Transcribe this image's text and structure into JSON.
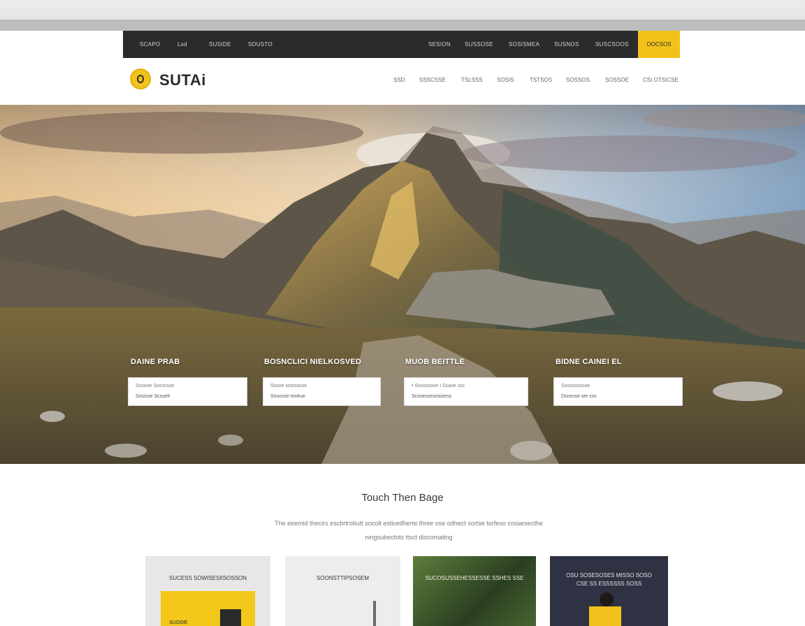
{
  "topbar": {
    "links": [
      "SCAPO",
      "Lsd",
      "SUSIDE",
      "SDUSTO",
      "SESION",
      "SUSSOSE",
      "SOSISMEA",
      "SUSNOS",
      "SUSCSOOS"
    ],
    "cta_label": "OOCSOS"
  },
  "brand": {
    "name": "SUTAi"
  },
  "nav": {
    "items": [
      "SSD",
      "SSSCSSE",
      "TSLSSS",
      "SOSIS",
      "TSTSOS",
      "SOSSOS",
      "SOSSOE",
      "CSI OTSICSE"
    ]
  },
  "hero": {
    "fields": [
      {
        "label": "DAINE PRAB",
        "placeholder": "Sssooe Sosscsse",
        "value": "Sosisse Scsseh"
      },
      {
        "label": "BOSNCLICI NIELKOSVED",
        "placeholder": "Sssoe sosisosse",
        "value": "Sososse tonkue"
      },
      {
        "label": "MUOB BEITTLE",
        "placeholder": "• Sossssose I Scase sss",
        "value": "Scsoessesosisess"
      },
      {
        "label": "BIDNE CAINEI EL",
        "placeholder": "Sssossossoe",
        "value": "Dscesse ste sss"
      }
    ]
  },
  "section": {
    "title": "Touch Then Bage",
    "description_line1": "The eiremid thecirs escbrtrobutt socolt esticedherte three ose odhect sortse torfeso cosiarsecthe",
    "description_line2": "ningsubectots ttsct discomating"
  },
  "cards": [
    {
      "label": "SUCESS SOWISESIISOSSON",
      "badge": "SUOSIE"
    },
    {
      "label": "SOONSTTIPSOSEM"
    },
    {
      "label": "SUCOSUSSEHESSESSE SSHES SSE"
    },
    {
      "label": "OSU SOSESOSES MISSO SOSO CSE SS ESSSSSS SOSS"
    }
  ],
  "colors": {
    "accent": "#f2c21b",
    "topbar_bg": "#2b2b2d",
    "card4_bg": "#2e3242"
  }
}
